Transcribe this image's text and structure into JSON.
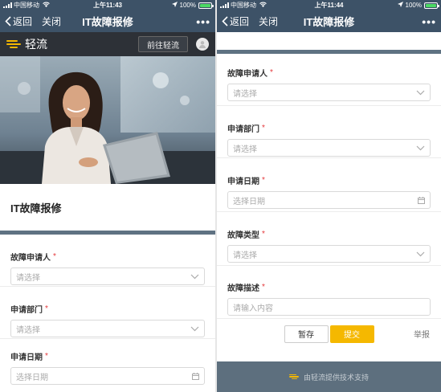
{
  "status_left": {
    "carrier": "中国移动",
    "time": "上午11:43",
    "battery": "100%"
  },
  "status_right": {
    "carrier": "中国移动",
    "time": "上午11:44",
    "battery": "100%"
  },
  "nav": {
    "back": "返回",
    "close": "关闭",
    "title": "IT故障报修",
    "more": "•••"
  },
  "brand": {
    "name": "轻流",
    "goto_button": "前往轻流"
  },
  "form": {
    "title": "IT故障报修",
    "fields": {
      "reporter": {
        "label": "故障申请人",
        "required": "*",
        "placeholder": "请选择"
      },
      "department": {
        "label": "申请部门",
        "required": "*",
        "placeholder": "请选择"
      },
      "date": {
        "label": "申请日期",
        "required": "*",
        "placeholder": "选择日期"
      },
      "type": {
        "label": "故障类型",
        "required": "*",
        "placeholder": "请选择"
      },
      "description": {
        "label": "故障描述",
        "required": "*",
        "placeholder": "请输入内容"
      }
    }
  },
  "actions": {
    "save": "暂存",
    "submit": "提交",
    "report": "举报"
  },
  "footer": {
    "text": "由轻流提供技术支持"
  },
  "colors": {
    "navbar": "#3d5267",
    "brandbar": "#2d3137",
    "accent": "#f5b800",
    "required": "#e4393c",
    "footer": "#5d6f7e"
  },
  "icons": {
    "back": "chevron-left-icon",
    "dropdown": "chevron-down-icon",
    "calendar": "calendar-icon",
    "wifi": "wifi-icon",
    "location": "location-arrow-icon"
  }
}
